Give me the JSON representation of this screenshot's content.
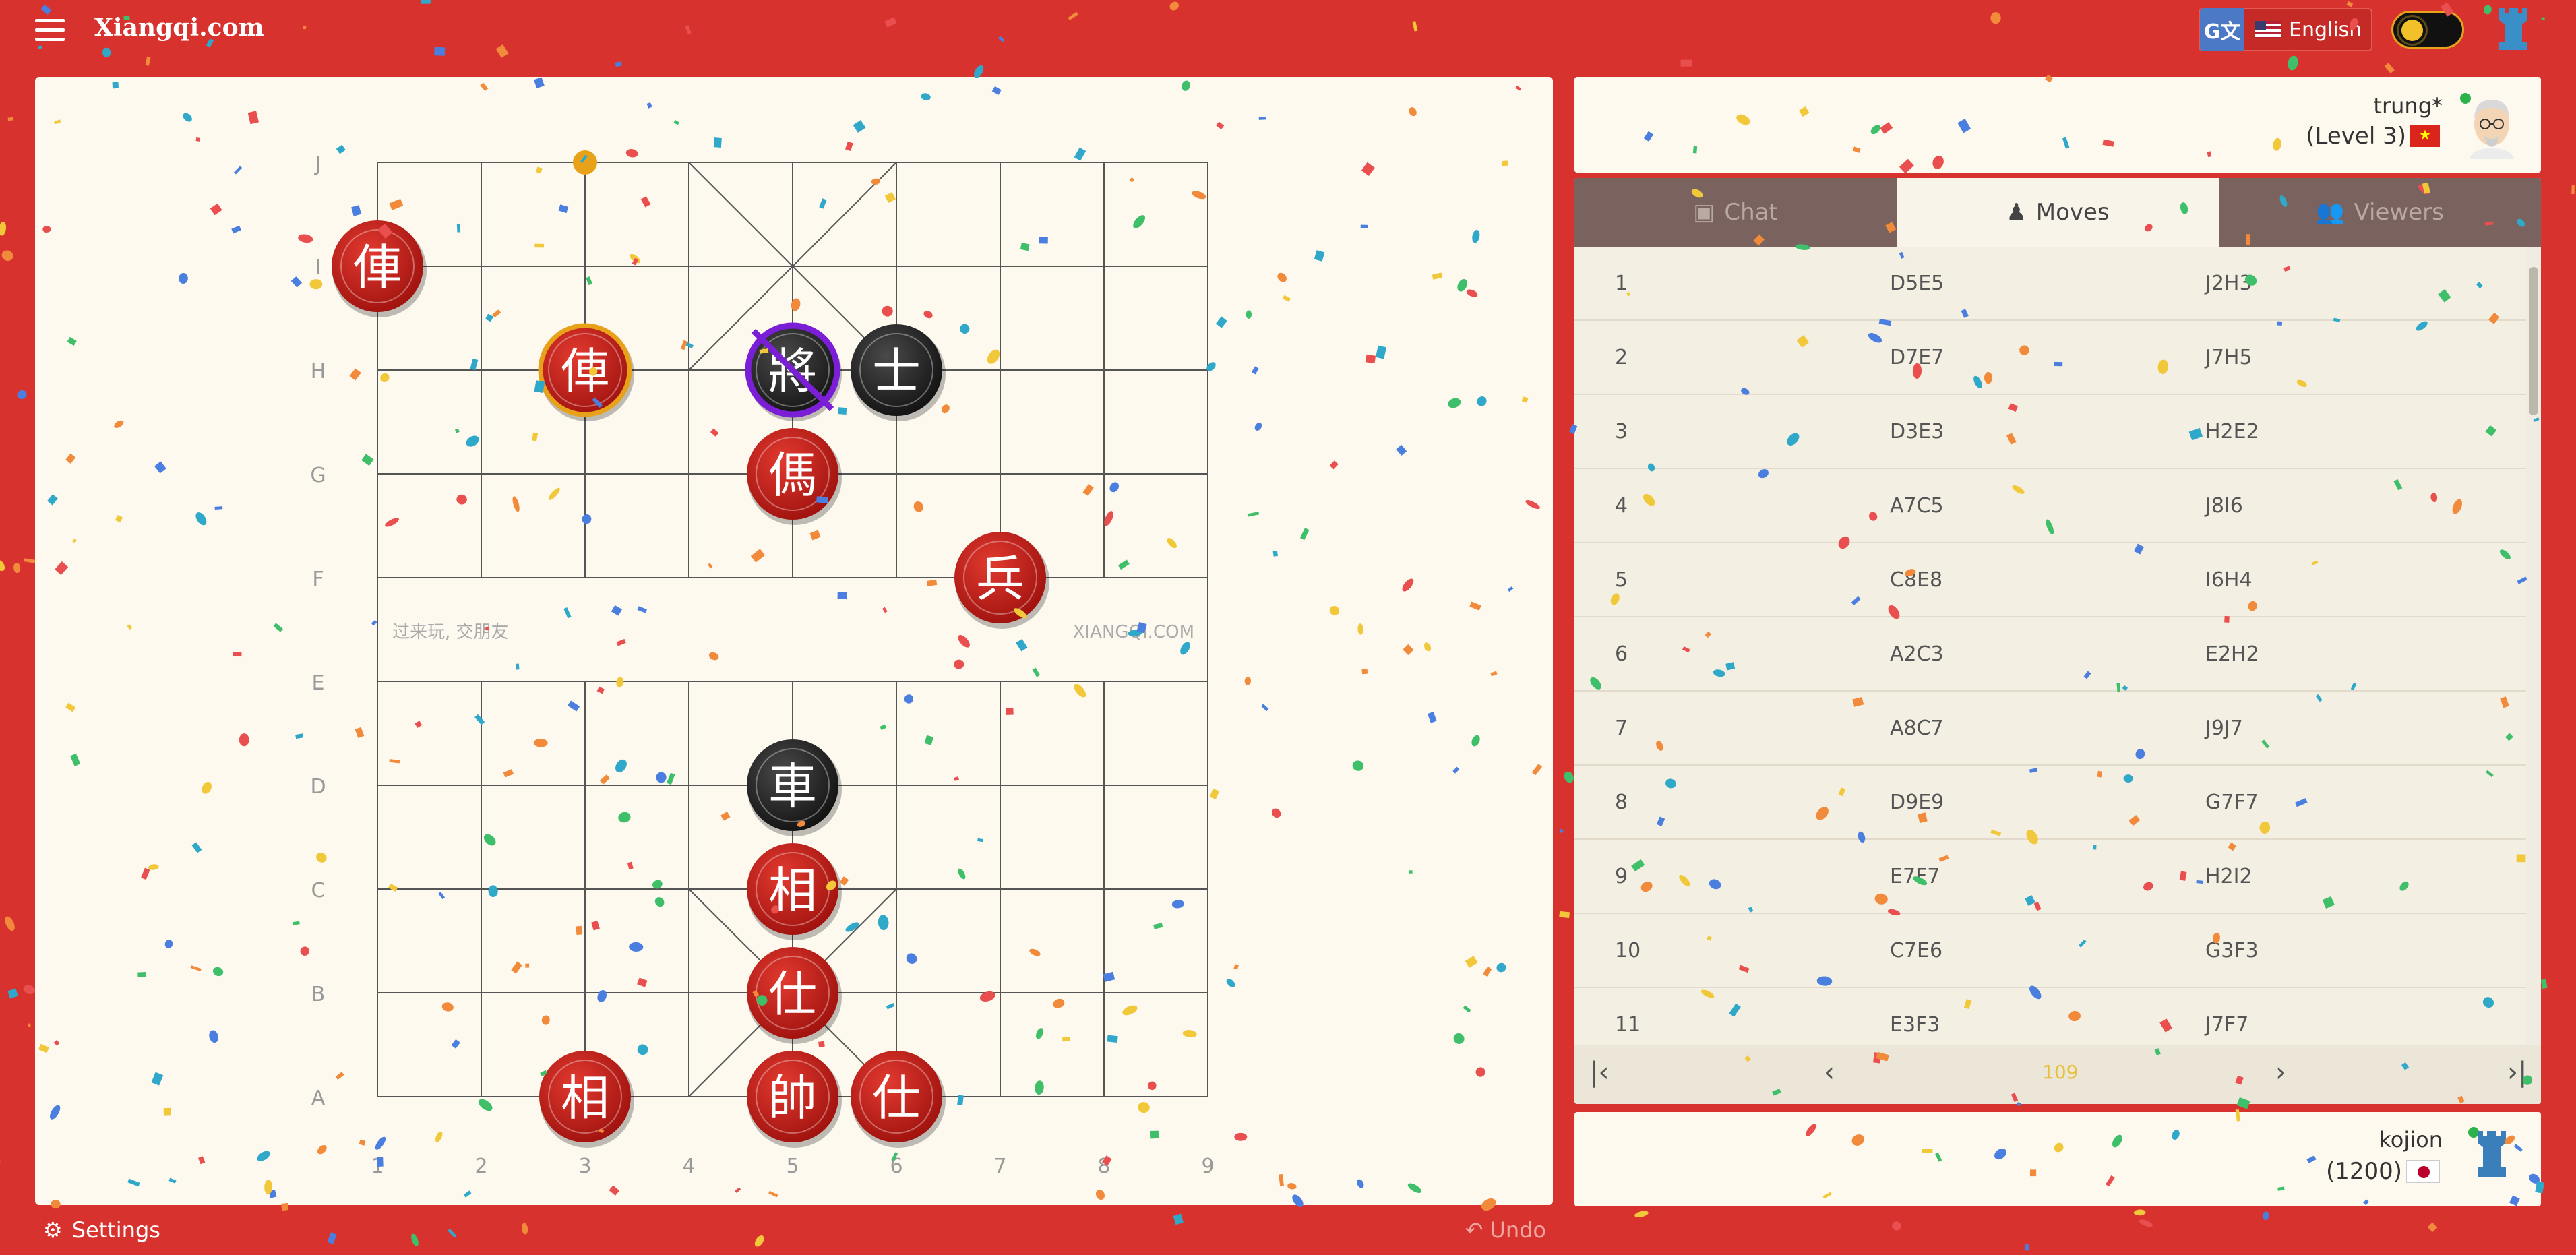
{
  "header": {
    "site_title": "Xiangqi.com",
    "language_label": "English",
    "translate_glyph": "G文"
  },
  "board": {
    "rank_labels": [
      "J",
      "I",
      "H",
      "G",
      "F",
      "E",
      "D",
      "C",
      "B",
      "A"
    ],
    "file_labels": [
      "1",
      "2",
      "3",
      "4",
      "5",
      "6",
      "7",
      "8",
      "9"
    ],
    "river_left_text": "过来玩, 交朋友",
    "river_right_text": "XIANGQI.COM",
    "pieces": [
      {
        "char": "俥",
        "side": "red",
        "file": 1,
        "rank": "I",
        "state": "normal"
      },
      {
        "char": "俥",
        "side": "red",
        "file": 3,
        "rank": "H",
        "state": "last-move"
      },
      {
        "char": "將",
        "side": "black",
        "file": 5,
        "rank": "H",
        "state": "checkmated"
      },
      {
        "char": "士",
        "side": "black",
        "file": 6,
        "rank": "H",
        "state": "normal"
      },
      {
        "char": "傌",
        "side": "red",
        "file": 5,
        "rank": "G",
        "state": "normal"
      },
      {
        "char": "兵",
        "side": "red",
        "file": 7,
        "rank": "F",
        "state": "normal"
      },
      {
        "char": "車",
        "side": "black",
        "file": 5,
        "rank": "D",
        "state": "normal"
      },
      {
        "char": "相",
        "side": "red",
        "file": 5,
        "rank": "C",
        "state": "normal"
      },
      {
        "char": "仕",
        "side": "red",
        "file": 5,
        "rank": "B",
        "state": "normal"
      },
      {
        "char": "相",
        "side": "red",
        "file": 3,
        "rank": "A",
        "state": "normal"
      },
      {
        "char": "帥",
        "side": "red",
        "file": 5,
        "rank": "A",
        "state": "normal"
      },
      {
        "char": "仕",
        "side": "red",
        "file": 6,
        "rank": "A",
        "state": "normal"
      }
    ],
    "last_move_from": {
      "file": 3,
      "rank": "J"
    }
  },
  "footer": {
    "settings_label": "Settings",
    "undo_label": "Undo"
  },
  "opponent": {
    "name": "trung*",
    "level": "(Level 3)"
  },
  "player": {
    "name": "kojion",
    "rating": "(1200)"
  },
  "tabs": [
    {
      "label": "Chat",
      "active": false
    },
    {
      "label": "Moves",
      "active": true
    },
    {
      "label": "Viewers",
      "active": false
    }
  ],
  "moves": [
    {
      "num": "1",
      "red": "D5E5",
      "black": "J2H3"
    },
    {
      "num": "2",
      "red": "D7E7",
      "black": "J7H5"
    },
    {
      "num": "3",
      "red": "D3E3",
      "black": "H2E2"
    },
    {
      "num": "4",
      "red": "A7C5",
      "black": "J8I6"
    },
    {
      "num": "5",
      "red": "C8E8",
      "black": "I6H4"
    },
    {
      "num": "6",
      "red": "A2C3",
      "black": "E2H2"
    },
    {
      "num": "7",
      "red": "A8C7",
      "black": "J9J7"
    },
    {
      "num": "8",
      "red": "D9E9",
      "black": "G7F7"
    },
    {
      "num": "9",
      "red": "E7F7",
      "black": "H2I2"
    },
    {
      "num": "10",
      "red": "C7E6",
      "black": "G3F3"
    },
    {
      "num": "11",
      "red": "E3F3",
      "black": "J7F7"
    }
  ],
  "move_counter": "109",
  "colors": {
    "background": "#d8322e",
    "panel": "#fdf9ef",
    "red_piece": "#c41a16",
    "black_piece": "#222222",
    "last_move_highlight": "#e8a21a",
    "checkmate_ring": "#7a1fd6",
    "tab_bar": "#7a625e"
  }
}
